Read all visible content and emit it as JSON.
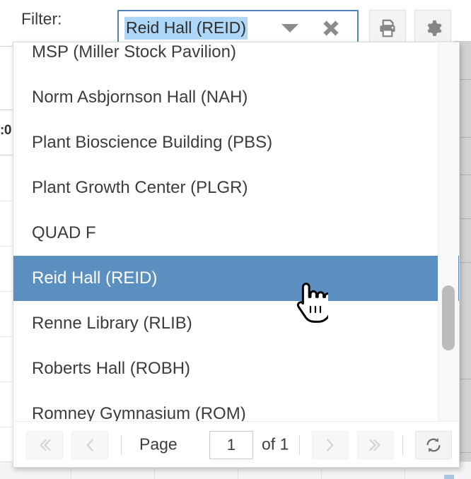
{
  "toolbar": {
    "filter_label": "Filter:",
    "filter_value": "Reid Hall (REID)",
    "caret_icon": "chevron-down-icon",
    "clear_icon": "clear-x-icon",
    "print_icon": "printer-icon",
    "gear_icon": "gear-icon"
  },
  "dropdown": {
    "items": [
      {
        "label": "MSP (Miller Stock Pavilion)",
        "selected": false
      },
      {
        "label": "Norm Asbjornson Hall (NAH)",
        "selected": false
      },
      {
        "label": "Plant Bioscience Building (PBS)",
        "selected": false
      },
      {
        "label": "Plant Growth Center (PLGR)",
        "selected": false
      },
      {
        "label": "QUAD F",
        "selected": false
      },
      {
        "label": "Reid Hall (REID)",
        "selected": true
      },
      {
        "label": "Renne Library (RLIB)",
        "selected": false
      },
      {
        "label": "Roberts Hall (ROBH)",
        "selected": false
      },
      {
        "label": "Romney Gymnasium (ROM)",
        "selected": false
      }
    ],
    "selected_color": "#5b8fc0",
    "scrollbar": {
      "name": "vertical-scrollbar"
    }
  },
  "pager": {
    "first_icon": "double-chevron-left-icon",
    "prev_icon": "chevron-left-icon",
    "page_label": "Page",
    "page_value": "1",
    "of_label": "of 1",
    "next_icon": "chevron-right-icon",
    "last_icon": "double-chevron-right-icon",
    "refresh_icon": "refresh-icon"
  },
  "background": {
    "time_label": ":0"
  },
  "cursor": {
    "type": "pointing-hand-cursor"
  }
}
